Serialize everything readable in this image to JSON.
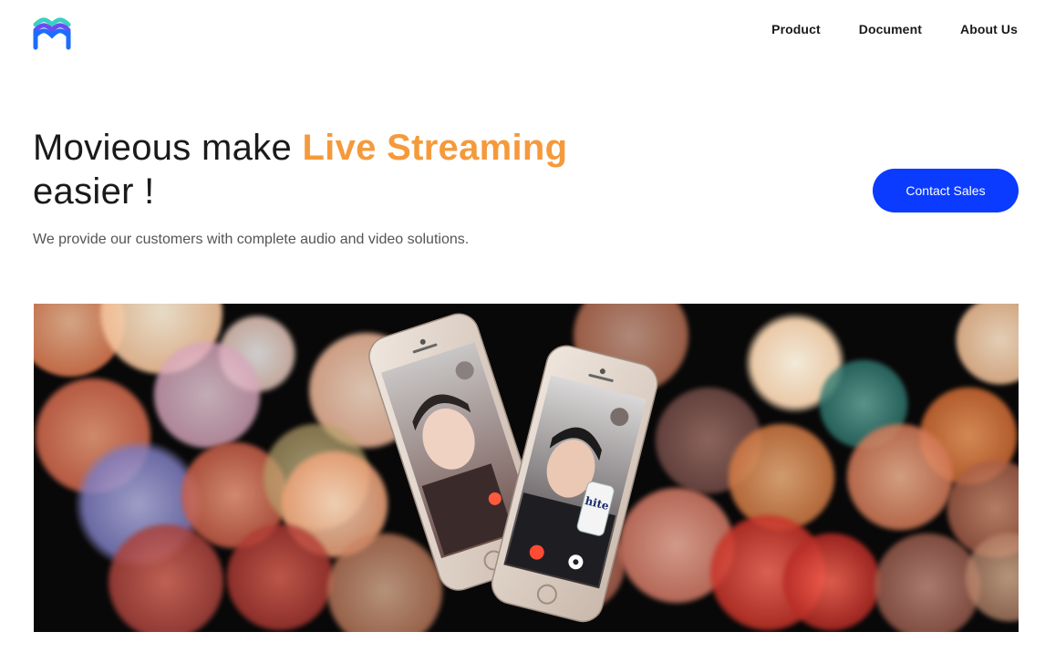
{
  "header": {
    "logo_alt": "M",
    "nav": [
      {
        "label": "Product"
      },
      {
        "label": "Document"
      },
      {
        "label": "About Us"
      }
    ]
  },
  "hero": {
    "title_prefix": "Movieous make ",
    "title_accent": "Live Streaming",
    "title_suffix": "easier !",
    "subtitle": "We provide our customers with complete audio and video solutions.",
    "cta_label": "Contact Sales"
  },
  "banner": {
    "can_label": "hite",
    "colors": {
      "accent_orange": "#f59a3c",
      "cta_blue": "#0a3bff"
    }
  }
}
